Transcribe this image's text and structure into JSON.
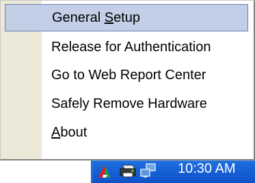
{
  "menu": {
    "items": [
      {
        "before": "General ",
        "underline": "S",
        "after": "etup"
      },
      {
        "before": "Release for Authentication",
        "underline": "",
        "after": ""
      },
      {
        "before": "Go to Web Report Center",
        "underline": "",
        "after": ""
      },
      {
        "before": "Safely Remove Hardware",
        "underline": "",
        "after": ""
      },
      {
        "before": "",
        "underline": "A",
        "after": "bout"
      }
    ],
    "highlighted_index": 0
  },
  "taskbar": {
    "clock": "10:30 AM",
    "icons": [
      "app-tray-icon",
      "printer-tray-icon",
      "network-tray-icon"
    ]
  },
  "colors": {
    "highlight": "#c2cfe6",
    "gutter": "#ece9d8",
    "taskbar_blue": "#1d6fe0"
  }
}
